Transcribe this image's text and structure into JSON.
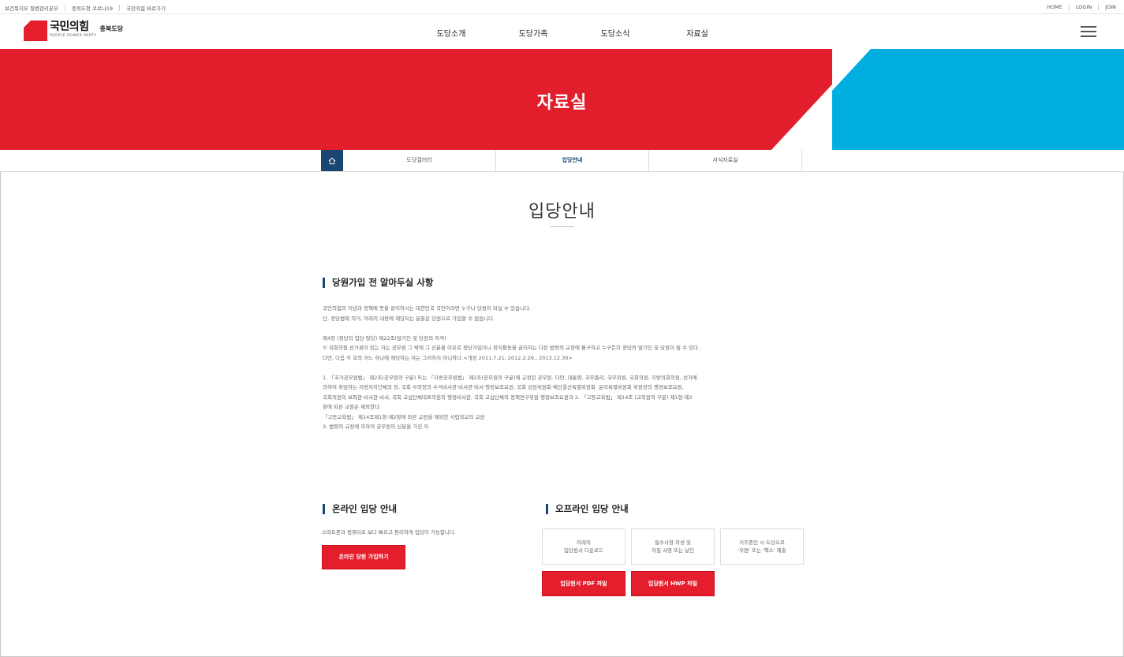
{
  "topbar": {
    "links": [
      "보건복지부 질병관리본부",
      "충북도청 코로나19",
      "국민의힘 바로가기"
    ],
    "auth": [
      "HOME",
      "LOGIN",
      "JOIN"
    ]
  },
  "logo": {
    "main": "국민의힘",
    "sub": "PEOPLE POWER PARTY",
    "region": "충북도당"
  },
  "nav": [
    "도당소개",
    "도당가족",
    "도당소식",
    "자료실"
  ],
  "banner": {
    "title": "자료실",
    "colors": {
      "red": "#e31e2c",
      "blue": "#00aee0"
    }
  },
  "subnav": {
    "items": [
      "도당갤러리",
      "입당안내",
      "서식자료실"
    ],
    "active": "입당안내"
  },
  "page_title": "입당안내",
  "notice": {
    "title": "당원가입 전 알아두실 사항",
    "lines": [
      "국민의힘의 이념과 정책에 뜻을 같이하시는 대한민국 국민이라면 누구나 당원이 되실 수 있습니다.",
      "단, 정당법에 의거, 아래의 내용에 해당되는 분들은 당원으로 가입할 수 없습니다.",
      "",
      "제4장 (정당의 입당·탈당) 제22조(발기인 및 당원의 자격)",
      "① 국회의원 선거권이 있는 자는 공무원 그 밖에 그 신분을 이유로 정당가입이나 정치활동을 금지하는 다른 법령의 규정에 불구하고 누구든지 정당의 발기인 및 당원이 될 수 있다.",
      "다만, 다음 각 호의 어느 하나에 해당하는 자는 그러하지 아니하다.<개정 2011.7.21, 2012.2.29., 2013.12.30>",
      "",
      "1. 「국가공무원법」 제2조(공무원의 구분) 또는 「지방공무원법」 제2조(공무원의 구분)에 규정된 공무원. 다만, 대통령, 국무총리, 국무위원, 국회의원, 지방의회의원, 선거에",
      "의하여 취임하는 지방자치단체의 장, 국회 부의장의 수석비서관·비서관·비서·행정보조요원, 국회 상임위원회·예산결산특별위원회· 윤리특별위원회 위원장의 행정보조요원,",
      "국회의원의 보좌관·비서관·비서, 국회 교섭단체대표의원의 행정비서관, 국회 교섭단체의 정책연구위원·행정보조요원과 2. 「고등교육법」 제14조 (교직원의 구분) 제1항·제2",
      "항에 따른 교원은 제외한다.",
      "「고등교육법」 제14조제1항·제2항에 따른 교원을 제외한 사립학교의 교원",
      "3. 법령의 규정에 의하여 공무원의 신분을 가진 자"
    ]
  },
  "online": {
    "title": "온라인 입당 안내",
    "desc": "스마트폰과 컴퓨터로 보다 빠르고 편리하게 입당이 가능합니다.",
    "button": "온라인 당원 가입하기"
  },
  "offline": {
    "title": "오프라인 입당 안내",
    "steps": [
      [
        "아래의",
        "입당원서 다운로드"
      ],
      [
        "필수사항 작성 및",
        "자필 서명 또는 날인"
      ],
      [
        "거주중인 시·도당으로",
        "'우편' 또는 '팩스' 제출"
      ]
    ],
    "buttons": [
      "입당원서 PDF 파일",
      "입당원서 HWP 파일"
    ]
  }
}
